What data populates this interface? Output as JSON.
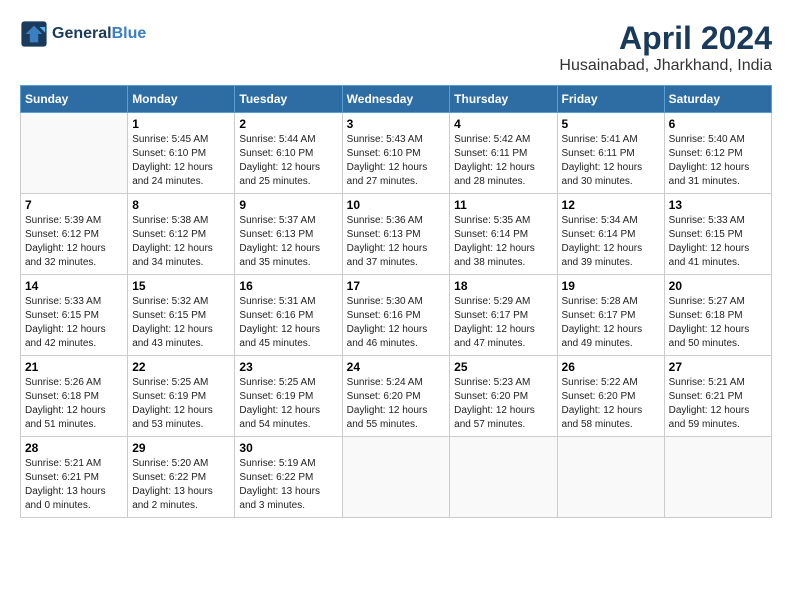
{
  "header": {
    "logo_line1": "General",
    "logo_line2": "Blue",
    "title": "April 2024",
    "subtitle": "Husainabad, Jharkhand, India"
  },
  "days_of_week": [
    "Sunday",
    "Monday",
    "Tuesday",
    "Wednesday",
    "Thursday",
    "Friday",
    "Saturday"
  ],
  "weeks": [
    [
      {
        "day": "",
        "sunrise": "",
        "sunset": "",
        "daylight": ""
      },
      {
        "day": "1",
        "sunrise": "Sunrise: 5:45 AM",
        "sunset": "Sunset: 6:10 PM",
        "daylight": "Daylight: 12 hours and 24 minutes."
      },
      {
        "day": "2",
        "sunrise": "Sunrise: 5:44 AM",
        "sunset": "Sunset: 6:10 PM",
        "daylight": "Daylight: 12 hours and 25 minutes."
      },
      {
        "day": "3",
        "sunrise": "Sunrise: 5:43 AM",
        "sunset": "Sunset: 6:10 PM",
        "daylight": "Daylight: 12 hours and 27 minutes."
      },
      {
        "day": "4",
        "sunrise": "Sunrise: 5:42 AM",
        "sunset": "Sunset: 6:11 PM",
        "daylight": "Daylight: 12 hours and 28 minutes."
      },
      {
        "day": "5",
        "sunrise": "Sunrise: 5:41 AM",
        "sunset": "Sunset: 6:11 PM",
        "daylight": "Daylight: 12 hours and 30 minutes."
      },
      {
        "day": "6",
        "sunrise": "Sunrise: 5:40 AM",
        "sunset": "Sunset: 6:12 PM",
        "daylight": "Daylight: 12 hours and 31 minutes."
      }
    ],
    [
      {
        "day": "7",
        "sunrise": "Sunrise: 5:39 AM",
        "sunset": "Sunset: 6:12 PM",
        "daylight": "Daylight: 12 hours and 32 minutes."
      },
      {
        "day": "8",
        "sunrise": "Sunrise: 5:38 AM",
        "sunset": "Sunset: 6:12 PM",
        "daylight": "Daylight: 12 hours and 34 minutes."
      },
      {
        "day": "9",
        "sunrise": "Sunrise: 5:37 AM",
        "sunset": "Sunset: 6:13 PM",
        "daylight": "Daylight: 12 hours and 35 minutes."
      },
      {
        "day": "10",
        "sunrise": "Sunrise: 5:36 AM",
        "sunset": "Sunset: 6:13 PM",
        "daylight": "Daylight: 12 hours and 37 minutes."
      },
      {
        "day": "11",
        "sunrise": "Sunrise: 5:35 AM",
        "sunset": "Sunset: 6:14 PM",
        "daylight": "Daylight: 12 hours and 38 minutes."
      },
      {
        "day": "12",
        "sunrise": "Sunrise: 5:34 AM",
        "sunset": "Sunset: 6:14 PM",
        "daylight": "Daylight: 12 hours and 39 minutes."
      },
      {
        "day": "13",
        "sunrise": "Sunrise: 5:33 AM",
        "sunset": "Sunset: 6:15 PM",
        "daylight": "Daylight: 12 hours and 41 minutes."
      }
    ],
    [
      {
        "day": "14",
        "sunrise": "Sunrise: 5:33 AM",
        "sunset": "Sunset: 6:15 PM",
        "daylight": "Daylight: 12 hours and 42 minutes."
      },
      {
        "day": "15",
        "sunrise": "Sunrise: 5:32 AM",
        "sunset": "Sunset: 6:15 PM",
        "daylight": "Daylight: 12 hours and 43 minutes."
      },
      {
        "day": "16",
        "sunrise": "Sunrise: 5:31 AM",
        "sunset": "Sunset: 6:16 PM",
        "daylight": "Daylight: 12 hours and 45 minutes."
      },
      {
        "day": "17",
        "sunrise": "Sunrise: 5:30 AM",
        "sunset": "Sunset: 6:16 PM",
        "daylight": "Daylight: 12 hours and 46 minutes."
      },
      {
        "day": "18",
        "sunrise": "Sunrise: 5:29 AM",
        "sunset": "Sunset: 6:17 PM",
        "daylight": "Daylight: 12 hours and 47 minutes."
      },
      {
        "day": "19",
        "sunrise": "Sunrise: 5:28 AM",
        "sunset": "Sunset: 6:17 PM",
        "daylight": "Daylight: 12 hours and 49 minutes."
      },
      {
        "day": "20",
        "sunrise": "Sunrise: 5:27 AM",
        "sunset": "Sunset: 6:18 PM",
        "daylight": "Daylight: 12 hours and 50 minutes."
      }
    ],
    [
      {
        "day": "21",
        "sunrise": "Sunrise: 5:26 AM",
        "sunset": "Sunset: 6:18 PM",
        "daylight": "Daylight: 12 hours and 51 minutes."
      },
      {
        "day": "22",
        "sunrise": "Sunrise: 5:25 AM",
        "sunset": "Sunset: 6:19 PM",
        "daylight": "Daylight: 12 hours and 53 minutes."
      },
      {
        "day": "23",
        "sunrise": "Sunrise: 5:25 AM",
        "sunset": "Sunset: 6:19 PM",
        "daylight": "Daylight: 12 hours and 54 minutes."
      },
      {
        "day": "24",
        "sunrise": "Sunrise: 5:24 AM",
        "sunset": "Sunset: 6:20 PM",
        "daylight": "Daylight: 12 hours and 55 minutes."
      },
      {
        "day": "25",
        "sunrise": "Sunrise: 5:23 AM",
        "sunset": "Sunset: 6:20 PM",
        "daylight": "Daylight: 12 hours and 57 minutes."
      },
      {
        "day": "26",
        "sunrise": "Sunrise: 5:22 AM",
        "sunset": "Sunset: 6:20 PM",
        "daylight": "Daylight: 12 hours and 58 minutes."
      },
      {
        "day": "27",
        "sunrise": "Sunrise: 5:21 AM",
        "sunset": "Sunset: 6:21 PM",
        "daylight": "Daylight: 12 hours and 59 minutes."
      }
    ],
    [
      {
        "day": "28",
        "sunrise": "Sunrise: 5:21 AM",
        "sunset": "Sunset: 6:21 PM",
        "daylight": "Daylight: 13 hours and 0 minutes."
      },
      {
        "day": "29",
        "sunrise": "Sunrise: 5:20 AM",
        "sunset": "Sunset: 6:22 PM",
        "daylight": "Daylight: 13 hours and 2 minutes."
      },
      {
        "day": "30",
        "sunrise": "Sunrise: 5:19 AM",
        "sunset": "Sunset: 6:22 PM",
        "daylight": "Daylight: 13 hours and 3 minutes."
      },
      {
        "day": "",
        "sunrise": "",
        "sunset": "",
        "daylight": ""
      },
      {
        "day": "",
        "sunrise": "",
        "sunset": "",
        "daylight": ""
      },
      {
        "day": "",
        "sunrise": "",
        "sunset": "",
        "daylight": ""
      },
      {
        "day": "",
        "sunrise": "",
        "sunset": "",
        "daylight": ""
      }
    ]
  ]
}
